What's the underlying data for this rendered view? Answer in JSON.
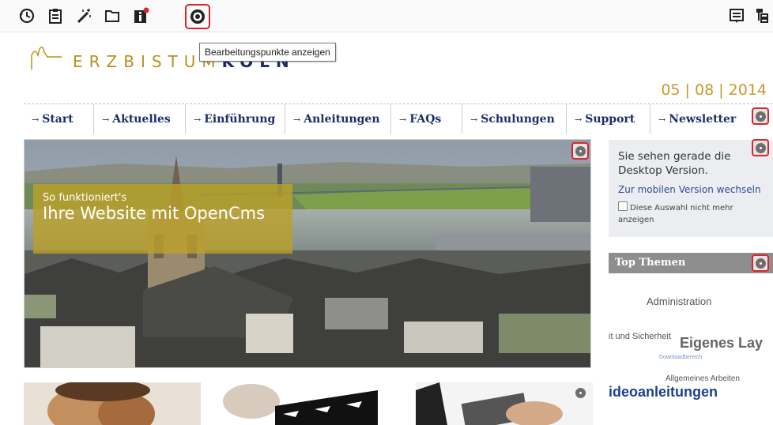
{
  "toolbar": {
    "left_icons": [
      "history-icon",
      "clipboard-icon",
      "magic-wand-icon",
      "folder-icon",
      "info-icon",
      "edit-points-icon"
    ],
    "right_icons": [
      "list-icon",
      "sitemap-icon"
    ],
    "tooltip": "Bearbeitungspunkte anzeigen"
  },
  "header": {
    "logo_text_a": "ERZBISTUM",
    "logo_text_b": "KÖLN",
    "date": "05 | 08 | 2014"
  },
  "nav": {
    "arrow": "→",
    "items": [
      "Start",
      "Aktuelles",
      "Einführung",
      "Anleitungen",
      "FAQs",
      "Schulungen",
      "Support",
      "Newsletter"
    ]
  },
  "hero": {
    "caption_small": "So funktioniert's",
    "caption_big": "Ihre Website mit OpenCms"
  },
  "sidebar": {
    "info_text": "Sie sehen gerade die Desktop Version.",
    "mobile_link": "Zur mobilen Version wechseln",
    "checkbox_label": "Diese Auswahl nicht mehr anzeigen",
    "top_themes_title": "Top Themen",
    "tags": [
      "Administration",
      "it und Sicherheit",
      "Eigenes Lay",
      "Downloadbereich",
      "Allgemeines Arbeiten",
      "ideoanleitungen"
    ]
  },
  "colors": {
    "accent_red": "#d8262e",
    "nav_blue": "#1c2e6a",
    "gold": "#c69a2a"
  }
}
